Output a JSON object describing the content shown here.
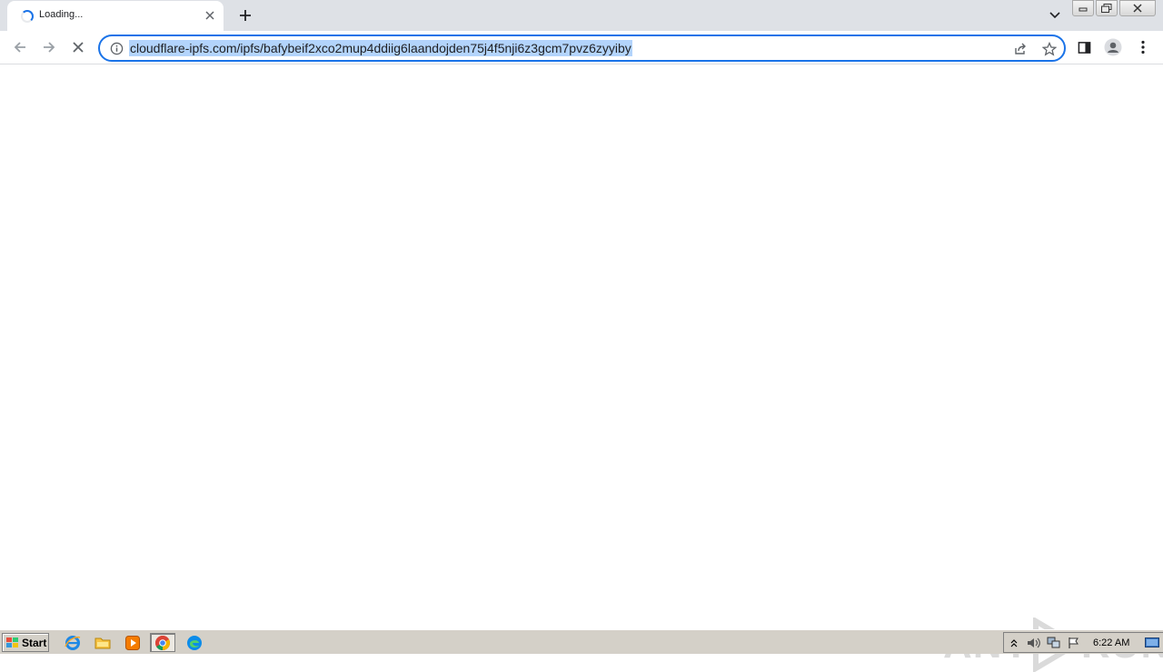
{
  "tab": {
    "title": "Loading..."
  },
  "omnibox": {
    "url": "cloudflare-ipfs.com/ipfs/bafybeif2xco2mup4ddiig6laandojden75j4f5nji6z3gcm7pvz6zyyiby"
  },
  "watermark": {
    "left": "ANY",
    "right": "RUN"
  },
  "taskbar": {
    "start_label": "Start",
    "clock": "6:22 AM"
  },
  "colors": {
    "accent": "#1a73e8",
    "selection": "#b3d4fc",
    "tabstrip": "#dee1e6",
    "taskbar": "#d4d0c8"
  }
}
